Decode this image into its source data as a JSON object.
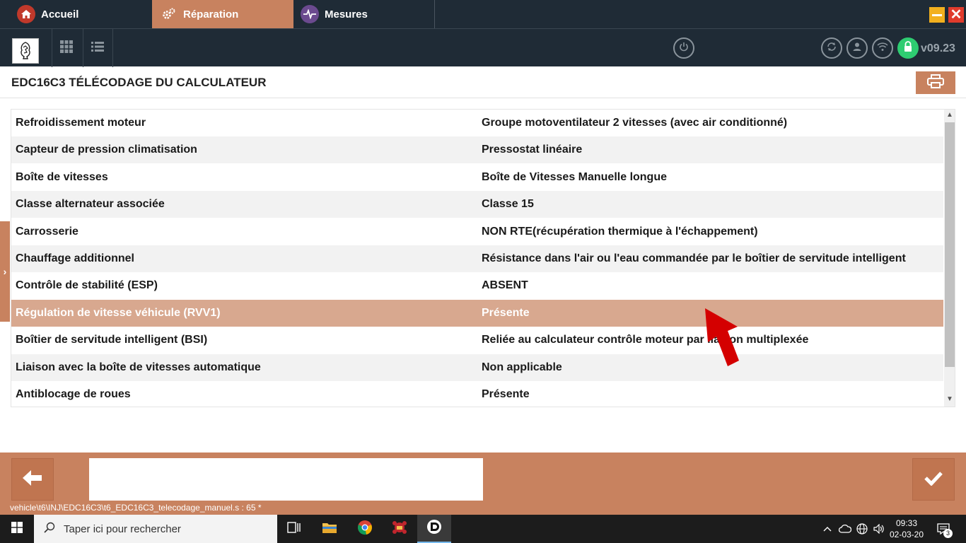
{
  "tabs": [
    {
      "label": "Accueil",
      "icon": "home-icon"
    },
    {
      "label": "Réparation",
      "icon": "gears-icon",
      "active": true
    },
    {
      "label": "Mesures",
      "icon": "pulse-icon"
    }
  ],
  "toolbar": {
    "logo": "PEUGEOT",
    "version": "v09.23"
  },
  "page": {
    "title": "EDC16C3 TÉLÉCODAGE DU CALCULATEUR"
  },
  "table": {
    "rows": [
      {
        "label": "Refroidissement moteur",
        "value": "Groupe motoventilateur 2 vitesses (avec air conditionné)"
      },
      {
        "label": "Capteur de pression climatisation",
        "value": "Pressostat linéaire"
      },
      {
        "label": "Boîte de vitesses",
        "value": "Boîte de Vitesses Manuelle longue"
      },
      {
        "label": "Classe alternateur associée",
        "value": "Classe 15"
      },
      {
        "label": "Carrosserie",
        "value": "NON RTE(récupération thermique à l'échappement)"
      },
      {
        "label": "Chauffage additionnel",
        "value": "Résistance dans l'air ou l'eau commandée par le boîtier de servitude intelligent"
      },
      {
        "label": "Contrôle de stabilité (ESP)",
        "value": "ABSENT"
      },
      {
        "label": "Régulation de vitesse véhicule (RVV1)",
        "value": "Présente",
        "selected": true
      },
      {
        "label": "Boîtier de servitude intelligent (BSI)",
        "value": "Reliée au calculateur contrôle moteur par liaison multiplexée"
      },
      {
        "label": "Liaison avec la boîte de vitesses automatique",
        "value": "Non applicable"
      },
      {
        "label": "Antiblocage de roues",
        "value": "Présente"
      }
    ]
  },
  "status": {
    "path": "vehicle\\t6\\INJ\\EDC16C3\\t6_EDC16C3_telecodage_manuel.s : 65 *"
  },
  "taskbar": {
    "search_placeholder": "Taper ici pour rechercher",
    "time": "09:33",
    "date": "02-03-20",
    "notifications": "3"
  },
  "colors": {
    "accent": "#c8825f",
    "header_bg": "#1f2b36",
    "selected_row": "#d8a88f",
    "annotation_arrow": "#d40000"
  }
}
